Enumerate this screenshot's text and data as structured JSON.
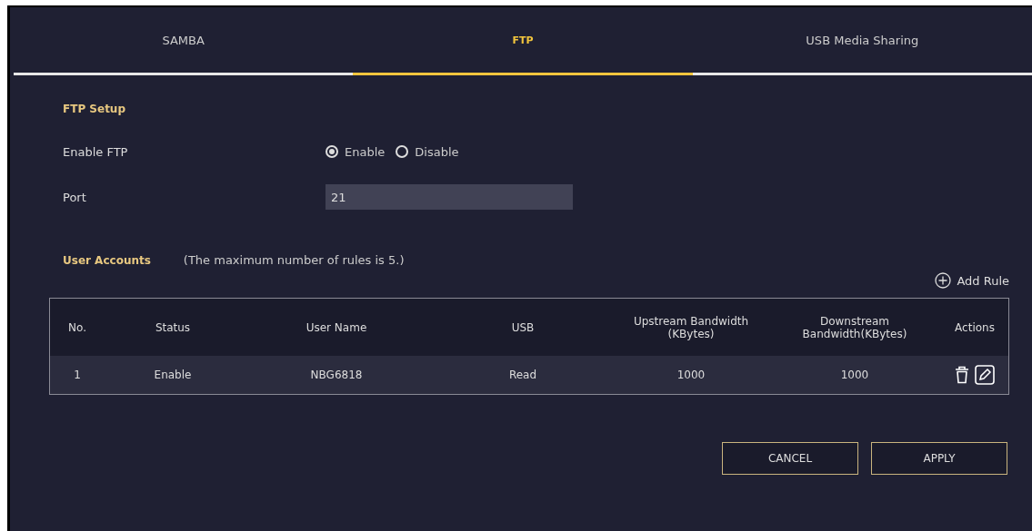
{
  "tabs": [
    {
      "label": "SAMBA",
      "selected": false
    },
    {
      "label": "FTP",
      "selected": true
    },
    {
      "label": "USB Media Sharing",
      "selected": false
    }
  ],
  "ftp_setup": {
    "title": "FTP Setup",
    "enable_ftp": {
      "label": "Enable FTP",
      "options": [
        {
          "label": "Enable",
          "selected": true
        },
        {
          "label": "Disable",
          "selected": false
        }
      ]
    },
    "port": {
      "label": "Port",
      "value": "21"
    }
  },
  "user_accounts": {
    "title": "User Accounts",
    "note": "(The maximum number of rules is 5.)",
    "add_rule": "Add Rule",
    "table": {
      "columns": [
        "No.",
        "Status",
        "User Name",
        "USB",
        "Upstream Bandwidth (KBytes)",
        "Downstream Bandwidth(KBytes)",
        "Actions"
      ],
      "rows": [
        {
          "cells": [
            "1",
            "Enable",
            "NBG6818",
            "Read",
            "1000",
            "1000"
          ]
        }
      ]
    }
  },
  "buttons": [
    "CANCEL",
    "APPLY"
  ]
}
